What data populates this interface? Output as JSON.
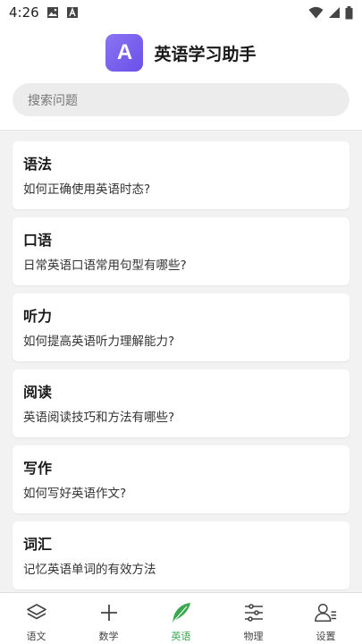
{
  "status_bar": {
    "time": "4:26"
  },
  "header": {
    "logo_letter": "A",
    "app_title": "英语学习助手",
    "search_placeholder": "搜索问题"
  },
  "topics": [
    {
      "title": "语法",
      "question": "如何正确使用英语时态?"
    },
    {
      "title": "口语",
      "question": "日常英语口语常用句型有哪些?"
    },
    {
      "title": "听力",
      "question": "如何提高英语听力理解能力?"
    },
    {
      "title": "阅读",
      "question": "英语阅读技巧和方法有哪些?"
    },
    {
      "title": "写作",
      "question": "如何写好英语作文?"
    },
    {
      "title": "词汇",
      "question": "记忆英语单词的有效方法"
    }
  ],
  "bottom_nav": [
    {
      "label": "语文",
      "icon": "layers-icon",
      "active": false
    },
    {
      "label": "数学",
      "icon": "plus-icon",
      "active": false
    },
    {
      "label": "英语",
      "icon": "feather-icon",
      "active": true
    },
    {
      "label": "物理",
      "icon": "sliders-icon",
      "active": false
    },
    {
      "label": "设置",
      "icon": "user-settings-icon",
      "active": false
    }
  ],
  "colors": {
    "accent": "#3aa84f",
    "logo_gradient_start": "#8b74f3",
    "logo_gradient_end": "#6a50e8"
  }
}
